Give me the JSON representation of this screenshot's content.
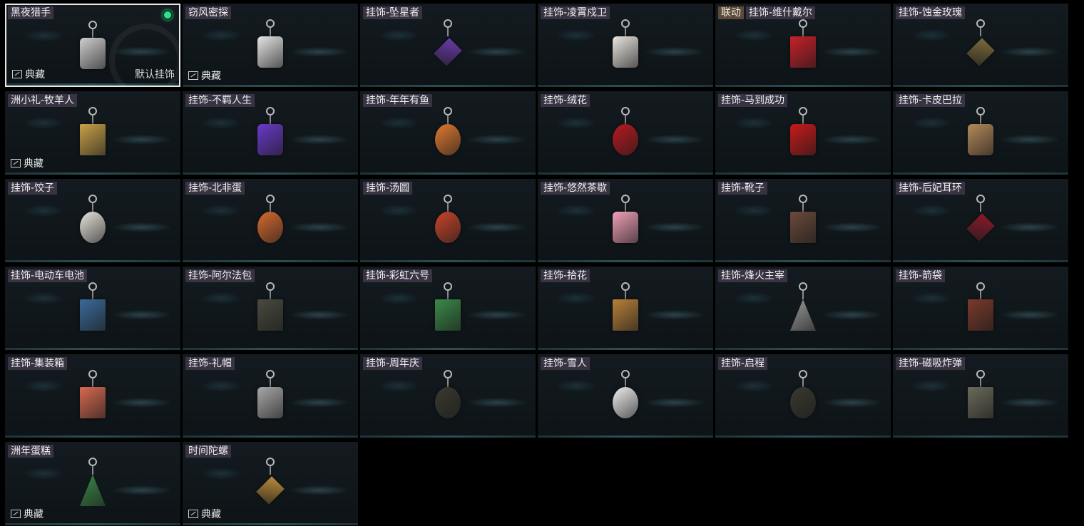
{
  "collection_label": "典藏",
  "default_label": "默认挂饰",
  "items": [
    {
      "name": "黑夜猎手",
      "selected": true,
      "collection": true,
      "default": true,
      "color": "#cfcfcf",
      "shape": "round"
    },
    {
      "name": "窃风密探",
      "collection": true,
      "color": "#e6e6e6",
      "shape": "round"
    },
    {
      "name": "挂饰-坠星者",
      "color": "#6a3aa8",
      "shape": "diamond"
    },
    {
      "name": "挂饰-凌霄戍卫",
      "color": "#e9e6e0",
      "shape": "round"
    },
    {
      "name": "挂饰-维什戴尔",
      "tag": "联动",
      "color": "#c8202a",
      "shape": "rect"
    },
    {
      "name": "挂饰-蚀金玫瑰",
      "color": "#7a6a3a",
      "shape": "diamond"
    },
    {
      "name": "洲小礼-牧羊人",
      "collection": true,
      "color": "#c9a24a",
      "shape": "rect"
    },
    {
      "name": "挂饰-不羁人生",
      "color": "#6a3ac8",
      "shape": "round"
    },
    {
      "name": "挂饰-年年有鱼",
      "color": "#e07a30",
      "shape": "circle"
    },
    {
      "name": "挂饰-绒花",
      "color": "#b81a20",
      "shape": "circle"
    },
    {
      "name": "挂饰-马到成功",
      "color": "#c81a1a",
      "shape": "round"
    },
    {
      "name": "挂饰-卡皮巴拉",
      "color": "#b58a5a",
      "shape": "round"
    },
    {
      "name": "挂饰-饺子",
      "color": "#e8e4dc",
      "shape": "circle"
    },
    {
      "name": "挂饰-北非蛋",
      "color": "#d86a30",
      "shape": "circle"
    },
    {
      "name": "挂饰-汤圆",
      "color": "#c8452a",
      "shape": "circle"
    },
    {
      "name": "挂饰-悠然茶歇",
      "color": "#f0a0b8",
      "shape": "round"
    },
    {
      "name": "挂饰-靴子",
      "color": "#6a4a3a",
      "shape": "rect"
    },
    {
      "name": "挂饰-后妃耳环",
      "color": "#8a1a2a",
      "shape": "diamond"
    },
    {
      "name": "挂饰-电动车电池",
      "color": "#3a6a9a",
      "shape": "rect"
    },
    {
      "name": "挂饰-阿尔法包",
      "color": "#4a4a40",
      "shape": "rect"
    },
    {
      "name": "挂饰-彩虹六号",
      "color": "#3a8a4a",
      "shape": "rect"
    },
    {
      "name": "挂饰-拾花",
      "color": "#b8803a",
      "shape": "rect"
    },
    {
      "name": "挂饰-烽火主宰",
      "color": "#9a9a9a",
      "shape": "tri"
    },
    {
      "name": "挂饰-箭袋",
      "color": "#7a3a2a",
      "shape": "rect"
    },
    {
      "name": "挂饰-集装箱",
      "color": "#d86a50",
      "shape": "rect"
    },
    {
      "name": "挂饰-礼帽",
      "color": "#a8a8a8",
      "shape": "round"
    },
    {
      "name": "挂饰-周年庆",
      "color": "#3a3a30",
      "shape": "circle"
    },
    {
      "name": "挂饰-雪人",
      "color": "#f0f0f0",
      "shape": "circle"
    },
    {
      "name": "挂饰-启程",
      "color": "#3a3a30",
      "shape": "circle"
    },
    {
      "name": "挂饰-磁吸炸弹",
      "color": "#6a6a5a",
      "shape": "rect"
    },
    {
      "name": "洲年蛋糕",
      "collection": true,
      "color": "#3a8a4a",
      "shape": "tri"
    },
    {
      "name": "时间陀螺",
      "collection": true,
      "color": "#b88a3a",
      "shape": "diamond"
    }
  ]
}
